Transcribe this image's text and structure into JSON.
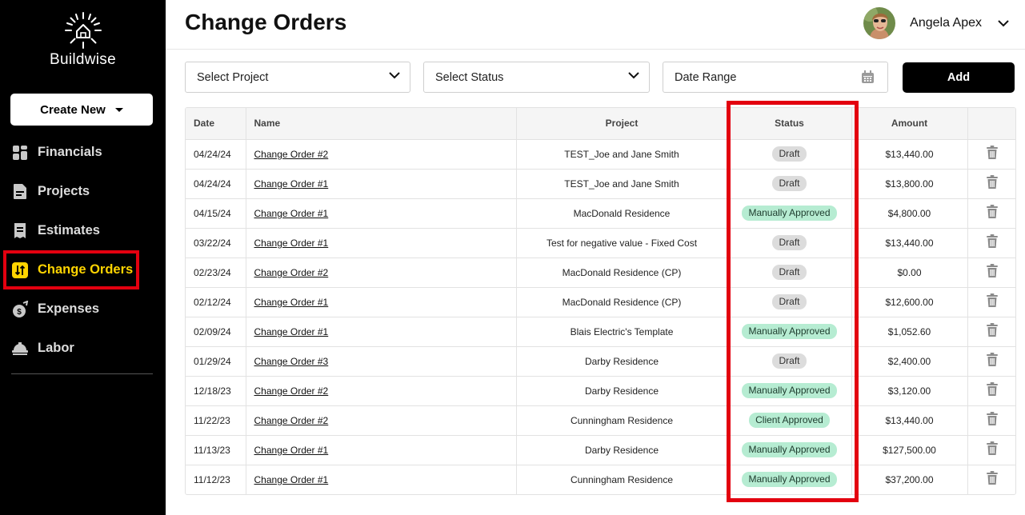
{
  "brand": {
    "name": "Buildwise"
  },
  "sidebar": {
    "create_new_label": "Create New",
    "items": [
      {
        "label": "Financials",
        "icon": "grid-icon"
      },
      {
        "label": "Projects",
        "icon": "document-icon"
      },
      {
        "label": "Estimates",
        "icon": "estimate-icon"
      },
      {
        "label": "Change Orders",
        "icon": "change-orders-icon",
        "active": true
      },
      {
        "label": "Expenses",
        "icon": "money-bag-icon"
      },
      {
        "label": "Labor",
        "icon": "hard-hat-icon"
      }
    ]
  },
  "header": {
    "title": "Change Orders",
    "user_name": "Angela Apex"
  },
  "filters": {
    "project_label": "Select Project",
    "status_label": "Select Status",
    "date_label": "Date Range",
    "add_label": "Add"
  },
  "table": {
    "columns": {
      "date": "Date",
      "name": "Name",
      "project": "Project",
      "status": "Status",
      "amount": "Amount"
    },
    "rows": [
      {
        "date": "04/24/24",
        "name": "Change Order #2",
        "project": "TEST_Joe and Jane Smith",
        "status": "Draft",
        "amount": "$13,440.00"
      },
      {
        "date": "04/24/24",
        "name": "Change Order #1",
        "project": "TEST_Joe and Jane Smith",
        "status": "Draft",
        "amount": "$13,800.00"
      },
      {
        "date": "04/15/24",
        "name": "Change Order #1",
        "project": "MacDonald Residence",
        "status": "Manually Approved",
        "amount": "$4,800.00"
      },
      {
        "date": "03/22/24",
        "name": "Change Order #1",
        "project": "Test for negative value - Fixed Cost",
        "status": "Draft",
        "amount": "$13,440.00"
      },
      {
        "date": "02/23/24",
        "name": "Change Order #2",
        "project": "MacDonald Residence (CP)",
        "status": "Draft",
        "amount": "$0.00"
      },
      {
        "date": "02/12/24",
        "name": "Change Order #1",
        "project": "MacDonald Residence (CP)",
        "status": "Draft",
        "amount": "$12,600.00"
      },
      {
        "date": "02/09/24",
        "name": "Change Order #1",
        "project": "Blais Electric's Template",
        "status": "Manually Approved",
        "amount": "$1,052.60"
      },
      {
        "date": "01/29/24",
        "name": "Change Order #3",
        "project": "Darby Residence",
        "status": "Draft",
        "amount": "$2,400.00"
      },
      {
        "date": "12/18/23",
        "name": "Change Order #2",
        "project": "Darby Residence",
        "status": "Manually Approved",
        "amount": "$3,120.00"
      },
      {
        "date": "11/22/23",
        "name": "Change Order #2",
        "project": "Cunningham Residence",
        "status": "Client Approved",
        "amount": "$13,440.00"
      },
      {
        "date": "11/13/23",
        "name": "Change Order #1",
        "project": "Darby Residence",
        "status": "Manually Approved",
        "amount": "$127,500.00"
      },
      {
        "date": "11/12/23",
        "name": "Change Order #1",
        "project": "Cunningham Residence",
        "status": "Manually Approved",
        "amount": "$37,200.00"
      }
    ]
  },
  "colors": {
    "sidebar_bg": "#000000",
    "active_nav": "#ffd400",
    "highlight": "#e3000f",
    "draft_badge": "#dcdcdc",
    "approved_badge": "#b6ecd2"
  }
}
